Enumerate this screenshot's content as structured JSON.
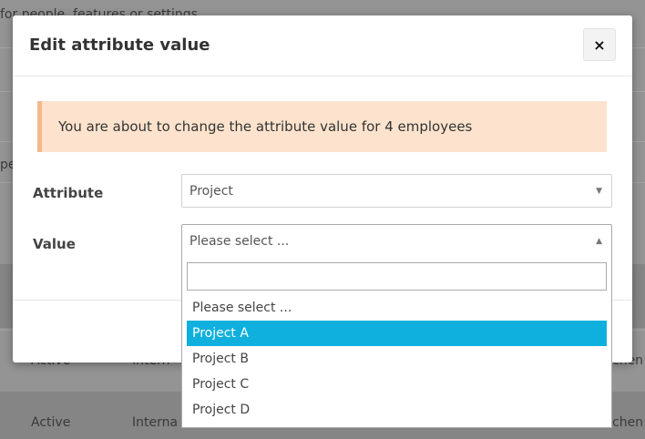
{
  "background": {
    "top_text": "for people, features or settings",
    "clipped_left_text": "pe",
    "rows": [
      {
        "status": "Active",
        "type": "Intern",
        "right": "chen"
      },
      {
        "status": "Active",
        "type": "Interna",
        "right": "chen"
      }
    ]
  },
  "modal": {
    "title": "Edit attribute value",
    "close_label": "×",
    "notice": "You are about to change the attribute value for 4 employees",
    "attribute": {
      "label": "Attribute",
      "value": "Project"
    },
    "value_field": {
      "label": "Value",
      "selected": "Please select ..."
    }
  },
  "dropdown": {
    "search_value": "",
    "options": [
      "Please select ...",
      "Project A",
      "Project B",
      "Project C",
      "Project D"
    ],
    "highlighted_index": 1
  },
  "colors": {
    "highlight": "#0fb0dd",
    "notice_bg": "#fde3cd",
    "notice_border": "#f5b88c"
  },
  "icons": {
    "search": "magnifier-icon",
    "close": "close-icon",
    "caret_down": "triangle-down-icon",
    "caret_up": "triangle-up-icon"
  }
}
